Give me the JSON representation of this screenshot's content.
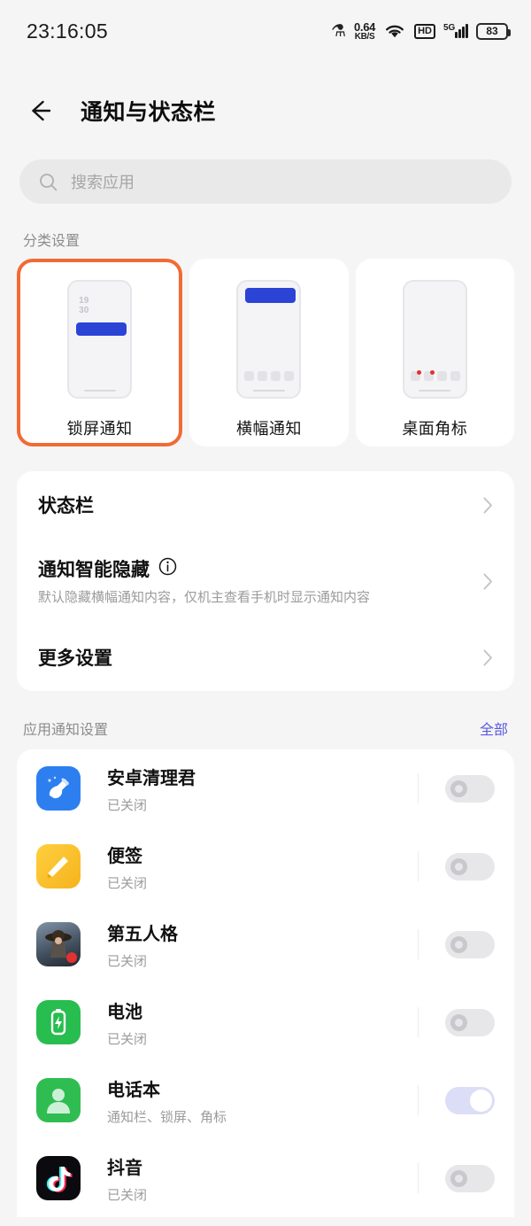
{
  "statusbar": {
    "time": "23:16:05",
    "bluetooth_icon": "bluetooth-icon",
    "net_speed_value": "0.64",
    "net_speed_unit": "KB/S",
    "wifi_icon": "wifi-icon",
    "hd_label": "HD",
    "network_type": "5G",
    "signal_icon": "signal-bars-icon",
    "battery_level": "83"
  },
  "header": {
    "back_icon": "back-arrow-icon",
    "title": "通知与状态栏"
  },
  "search": {
    "icon": "search-icon",
    "placeholder": "搜索应用",
    "value": ""
  },
  "categories": {
    "label": "分类设置",
    "items": [
      {
        "label": "锁屏通知",
        "selected": true,
        "preview": "lock-screen-preview",
        "lock_time_line1": "19",
        "lock_time_line2": "30"
      },
      {
        "label": "横幅通知",
        "selected": false,
        "preview": "banner-preview"
      },
      {
        "label": "桌面角标",
        "selected": false,
        "preview": "badge-preview"
      }
    ],
    "selected_border_color": "#f26a35",
    "preview_accent_color": "#2b44d6",
    "badge_dot_color": "#e0322e"
  },
  "settings": {
    "rows": [
      {
        "title": "状态栏",
        "subtitle": "",
        "has_info": false,
        "chevron": "chevron-right-icon"
      },
      {
        "title": "通知智能隐藏",
        "subtitle": "默认隐藏横幅通知内容，仅机主查看手机时显示通知内容",
        "has_info": true,
        "info_icon": "info-circle-icon",
        "chevron": "chevron-right-icon"
      },
      {
        "title": "更多设置",
        "subtitle": "",
        "has_info": false,
        "chevron": "chevron-right-icon"
      }
    ]
  },
  "apps": {
    "section_label": "应用通知设置",
    "all_link": "全部",
    "all_link_color": "#5a5ae0",
    "items": [
      {
        "name": "安卓清理君",
        "status": "已关闭",
        "enabled": false,
        "icon": "broom-app-icon",
        "icon_color": "#2d7ff0"
      },
      {
        "name": "便签",
        "status": "已关闭",
        "enabled": false,
        "icon": "notes-app-icon",
        "icon_color": "#f5b31d"
      },
      {
        "name": "第五人格",
        "status": "已关闭",
        "enabled": false,
        "icon": "identityv-app-icon",
        "icon_color": "#3f4d5c"
      },
      {
        "name": "电池",
        "status": "已关闭",
        "enabled": false,
        "icon": "battery-app-icon",
        "icon_color": "#27bd4f"
      },
      {
        "name": "电话本",
        "status": "通知栏、锁屏、角标",
        "enabled": true,
        "icon": "contacts-app-icon",
        "icon_color": "#2fbd52"
      },
      {
        "name": "抖音",
        "status": "已关闭",
        "enabled": false,
        "icon": "douyin-app-icon",
        "icon_color": "#0b0b0f"
      }
    ],
    "toggle_on_color": "#dcdef7",
    "toggle_off_color": "#e7e7e9"
  }
}
